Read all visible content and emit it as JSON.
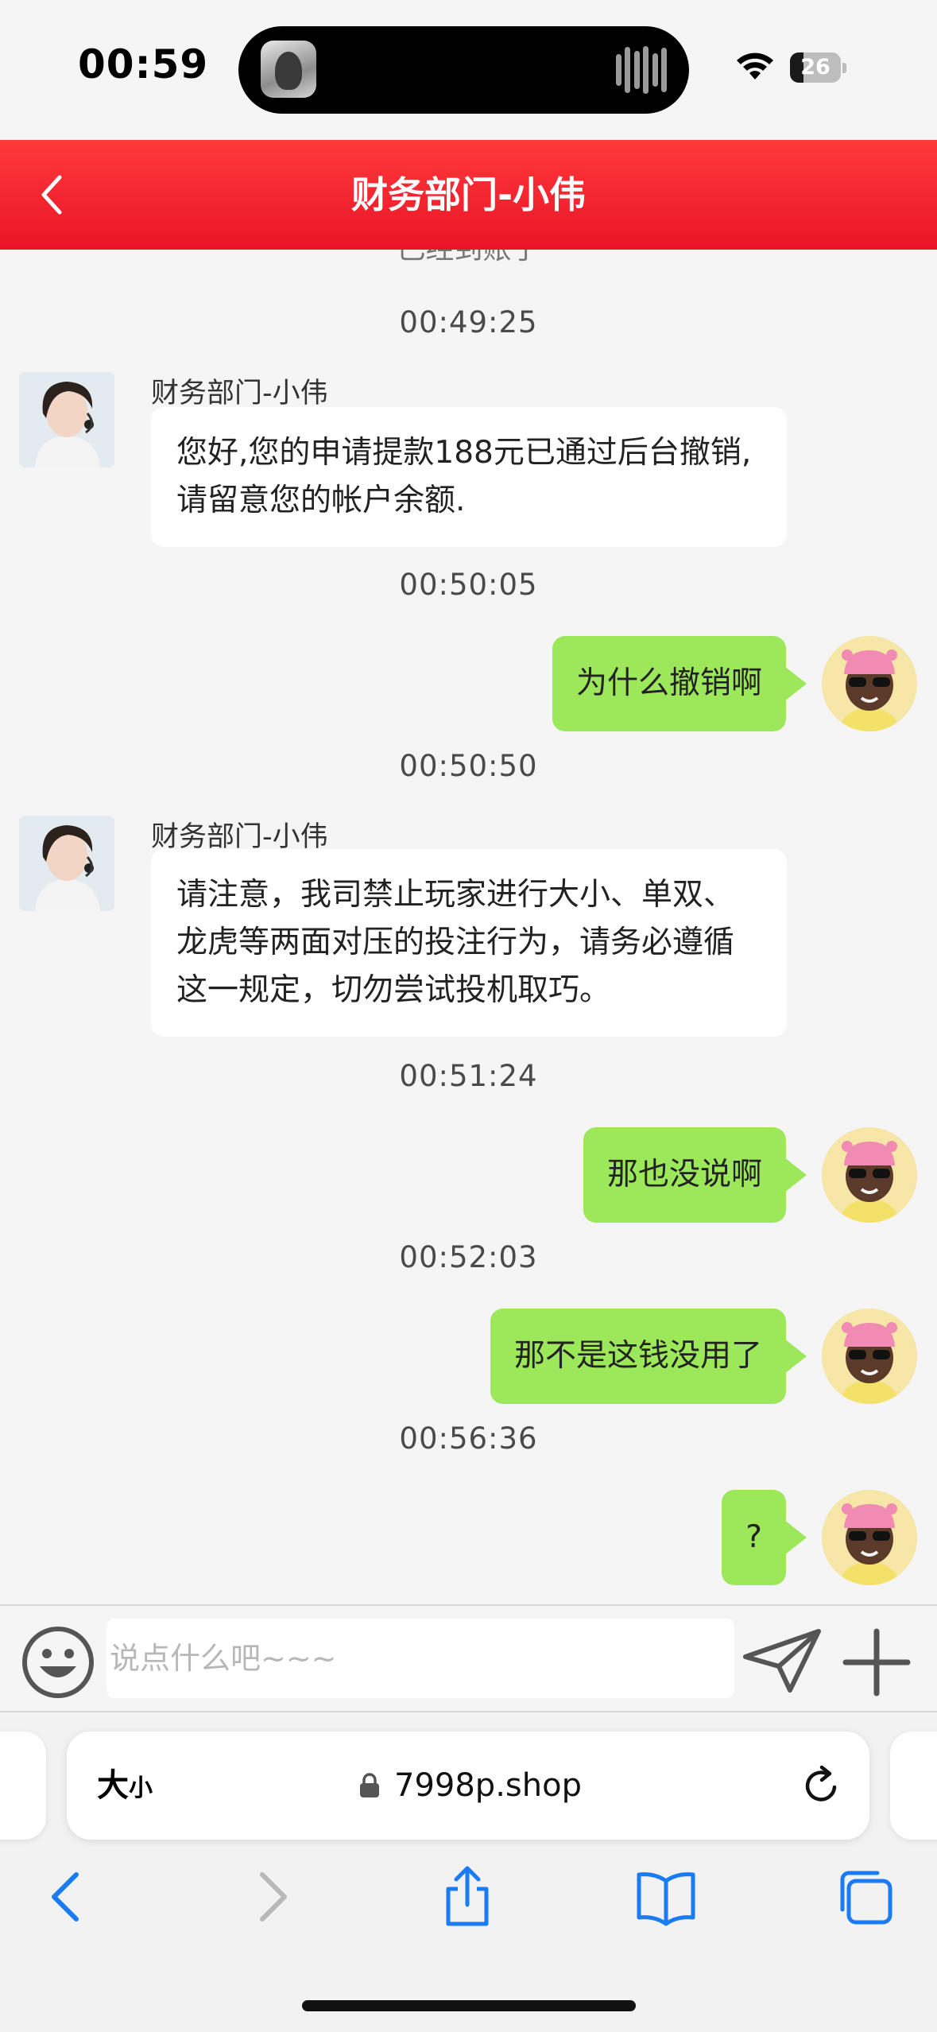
{
  "status_bar": {
    "time": "00:59",
    "battery": "26",
    "battery_fraction": 0.26
  },
  "header": {
    "title": "财务部门-小伟"
  },
  "chat": {
    "cutoff_text": "已经到账了",
    "timestamps": [
      "00:49:25",
      "00:50:05",
      "00:50:50",
      "00:51:24",
      "00:52:03",
      "00:56:36"
    ],
    "agent_name": "财务部门-小伟",
    "incoming": [
      "您好,您的申请提款188元已通过后台撤销,请留意您的帐户余额.",
      "请注意，我司禁止玩家进行大小、单双、龙虎等两面对压的投注行为，请务必遵循这一规定，切勿尝试投机取巧。"
    ],
    "outgoing": [
      "为什么撤销啊",
      "那也没说啊",
      "那不是这钱没用了",
      "?"
    ]
  },
  "input": {
    "placeholder": "说点什么吧~~~",
    "value": ""
  },
  "browser": {
    "aa_big": "大",
    "aa_small": "小",
    "url": "7998p.shop"
  },
  "icons": {
    "back": "chevron-left-icon",
    "emoji": "smiley-icon",
    "send": "paper-plane-icon",
    "plus": "plus-icon",
    "lock": "lock-icon",
    "reload": "reload-icon",
    "nav_back": "chevron-left-icon",
    "nav_forward": "chevron-right-icon",
    "share": "share-icon",
    "bookmarks": "book-icon",
    "tabs": "tabs-icon"
  },
  "colors": {
    "header": "#ef1f2e",
    "outgoing_bubble": "#9de85a",
    "incoming_bubble": "#ffffff",
    "safari_blue": "#1a7cf5"
  }
}
